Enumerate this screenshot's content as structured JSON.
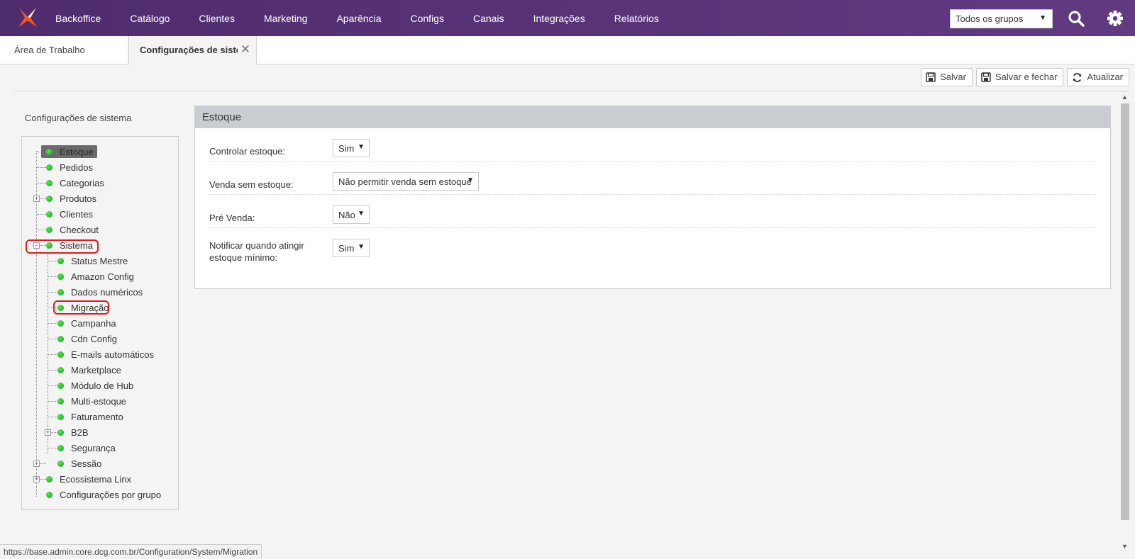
{
  "nav": {
    "items": [
      "Backoffice",
      "Catálogo",
      "Clientes",
      "Marketing",
      "Aparência",
      "Configs",
      "Canais",
      "Integrações",
      "Relatórios"
    ],
    "group_select": "Todos os grupos"
  },
  "tabs": {
    "home": "Área de Trabalho",
    "active": "Configurações de sistema"
  },
  "toolbar": {
    "save": "Salvar",
    "save_close": "Salvar e fechar",
    "refresh": "Atualizar"
  },
  "sidebar": {
    "title": "Configurações de sistema",
    "tree": [
      "Estoque",
      "Pedidos",
      "Categorias",
      "Produtos",
      "Clientes",
      "Checkout",
      "Sistema",
      "Status Mestre",
      "Amazon Config",
      "Dados numéricos",
      "Migração",
      "Campanha",
      "Cdn Config",
      "E-mails automáticos",
      "Marketplace",
      "Módulo de Hub",
      "Multi-estoque",
      "Faturamento",
      "B2B",
      "Segurança",
      "Sessão",
      "Ecossistema Linx",
      "Configurações por grupo"
    ]
  },
  "panel": {
    "title": "Estoque",
    "fields": [
      {
        "label": "Controlar estoque:",
        "value": "Sim"
      },
      {
        "label": "Venda sem estoque:",
        "value": "Não permitir venda sem estoque"
      },
      {
        "label": "Pré Venda:",
        "value": "Não"
      },
      {
        "label_line1": "Notificar quando atingir",
        "label_line2": "estoque mínimo:",
        "value": "Sim"
      }
    ]
  },
  "status_url": "https://base.admin.core.dcg.com.br/Configuration/System/Migration",
  "colors": {
    "nav_bg": "#5a3479",
    "logo_orange": "#f15a22",
    "highlight_red": "#e0191f",
    "node_green": "#14a014",
    "panel_header": "#c9cdd2"
  }
}
